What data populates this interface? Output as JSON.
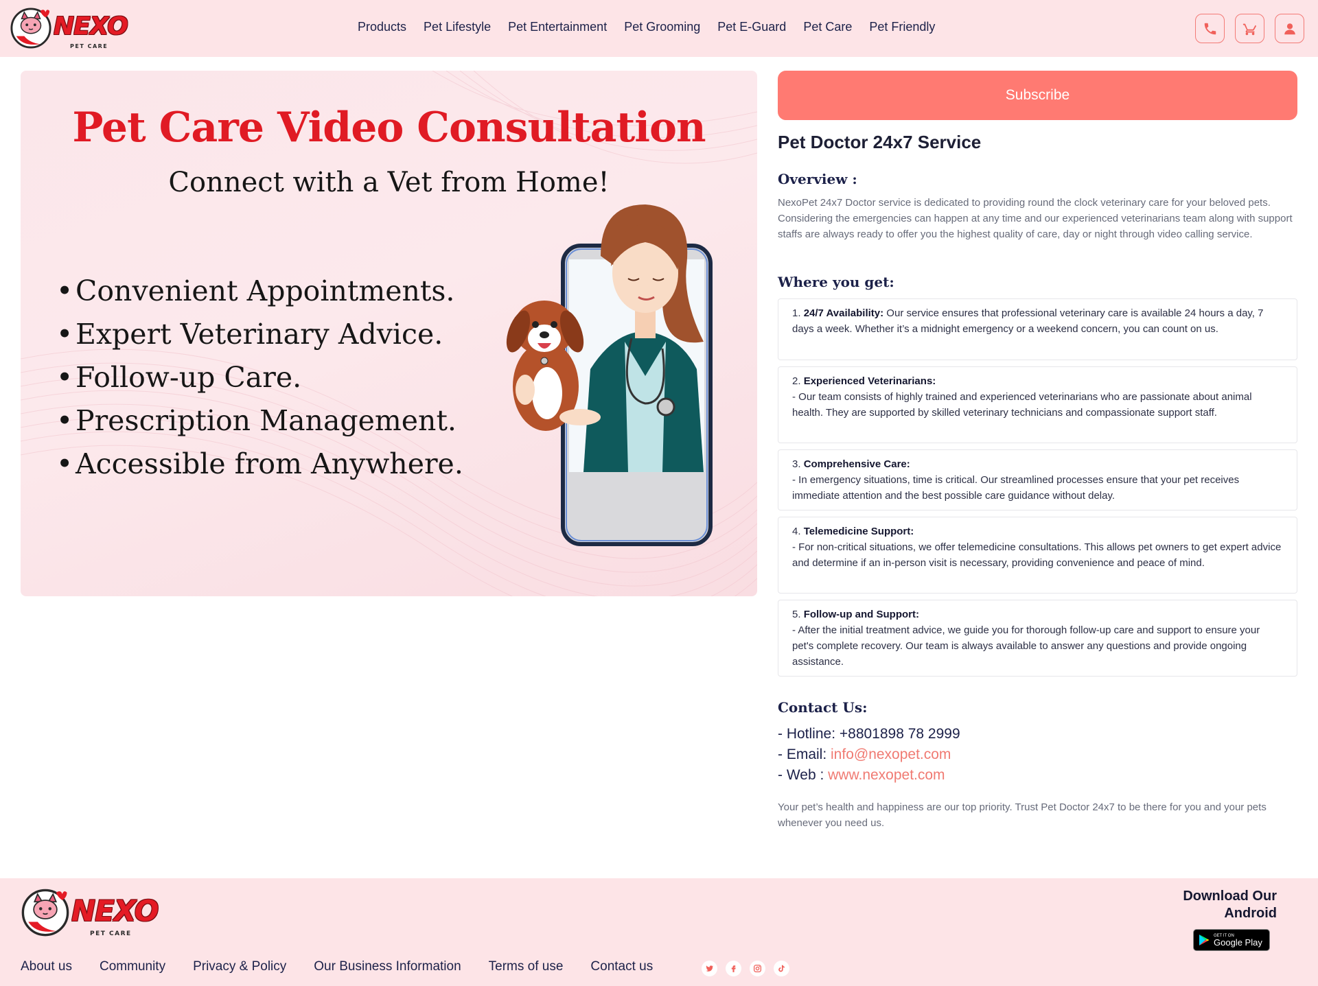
{
  "brand": {
    "name": "NEXO",
    "tagline": "PET CARE"
  },
  "nav": {
    "items": [
      "Products",
      "Pet Lifestyle",
      "Pet Entertainment",
      "Pet Grooming",
      "Pet E-Guard",
      "Pet Care",
      "Pet Friendly"
    ]
  },
  "header_icons": [
    "phone-icon",
    "cart-icon",
    "user-icon"
  ],
  "banner": {
    "title": "Pet Care Video Consultation",
    "subtitle": "Connect with a Vet from Home!",
    "bullets": [
      "Convenient Appointments.",
      "Expert Veterinary Advice.",
      "Follow-up Care.",
      "Prescription Management.",
      "Accessible from Anywhere."
    ],
    "bullet_char": "•"
  },
  "subscribe_label": "Subscribe",
  "service": {
    "title": "Pet Doctor 24x7 Service",
    "overview_heading": "Overview :",
    "overview_text": "NexoPet 24x7 Doctor service is dedicated to providing round the clock veterinary care for your beloved pets. Considering the emergencies can happen at any time and our experienced veterinarians team along with support staffs are always ready to offer you the highest quality of care, day or night through video calling service.",
    "where_heading": "Where you get:",
    "features": [
      {
        "num": "1.",
        "title": "24/7 Availability:",
        "text": " Our service ensures that professional veterinary care is available 24 hours a day, 7 days a week. Whether it’s a midnight emergency or a weekend concern, you can count on us."
      },
      {
        "num": "2.",
        "title": "Experienced Veterinarians:",
        "text": "- Our team consists of highly trained and experienced veterinarians who are passionate about animal health. They are supported by skilled veterinary technicians and compassionate support staff."
      },
      {
        "num": "3.",
        "title": "Comprehensive Care:",
        "text": "- In emergency situations, time is critical. Our streamlined processes ensure that your pet receives immediate attention and the best possible care guidance without delay."
      },
      {
        "num": "4.",
        "title": "Telemedicine Support:",
        "text": "- For non-critical situations, we offer telemedicine consultations. This allows pet owners to get expert advice and determine if an in-person visit is necessary, providing convenience and peace of mind."
      },
      {
        "num": "5.",
        "title": "Follow-up and Support:",
        "text": "- After the initial treatment advice, we guide you for thorough follow-up care and support to ensure your pet's complete recovery. Our team is always available to answer any questions and provide ongoing assistance."
      }
    ],
    "contact_heading": "Contact Us:",
    "hotline_label": "- Hotline: ",
    "hotline": "+8801898 78 2999",
    "email_label": "- Email: ",
    "email": "info@nexopet.com",
    "web_label": "- Web : ",
    "web": "www.nexopet.com",
    "closing": "Your pet’s health and happiness are our top priority. Trust Pet Doctor 24x7 to be there for you and your pets whenever you need us."
  },
  "footer": {
    "links": [
      "About us",
      "Community",
      "Privacy & Policy",
      "Our Business Information",
      "Terms of use",
      "Contact us"
    ],
    "socials": [
      "twitter-icon",
      "facebook-icon",
      "instagram-icon",
      "tiktok-icon"
    ],
    "download_line1": "Download Our",
    "download_line2": "Android",
    "store_small": "GET IT ON",
    "store_big": "Google Play"
  },
  "colors": {
    "header_bg": "#fde4e7",
    "accent": "#ff7a72",
    "brand_red": "#e41b25",
    "nav_text": "#1c2149"
  }
}
